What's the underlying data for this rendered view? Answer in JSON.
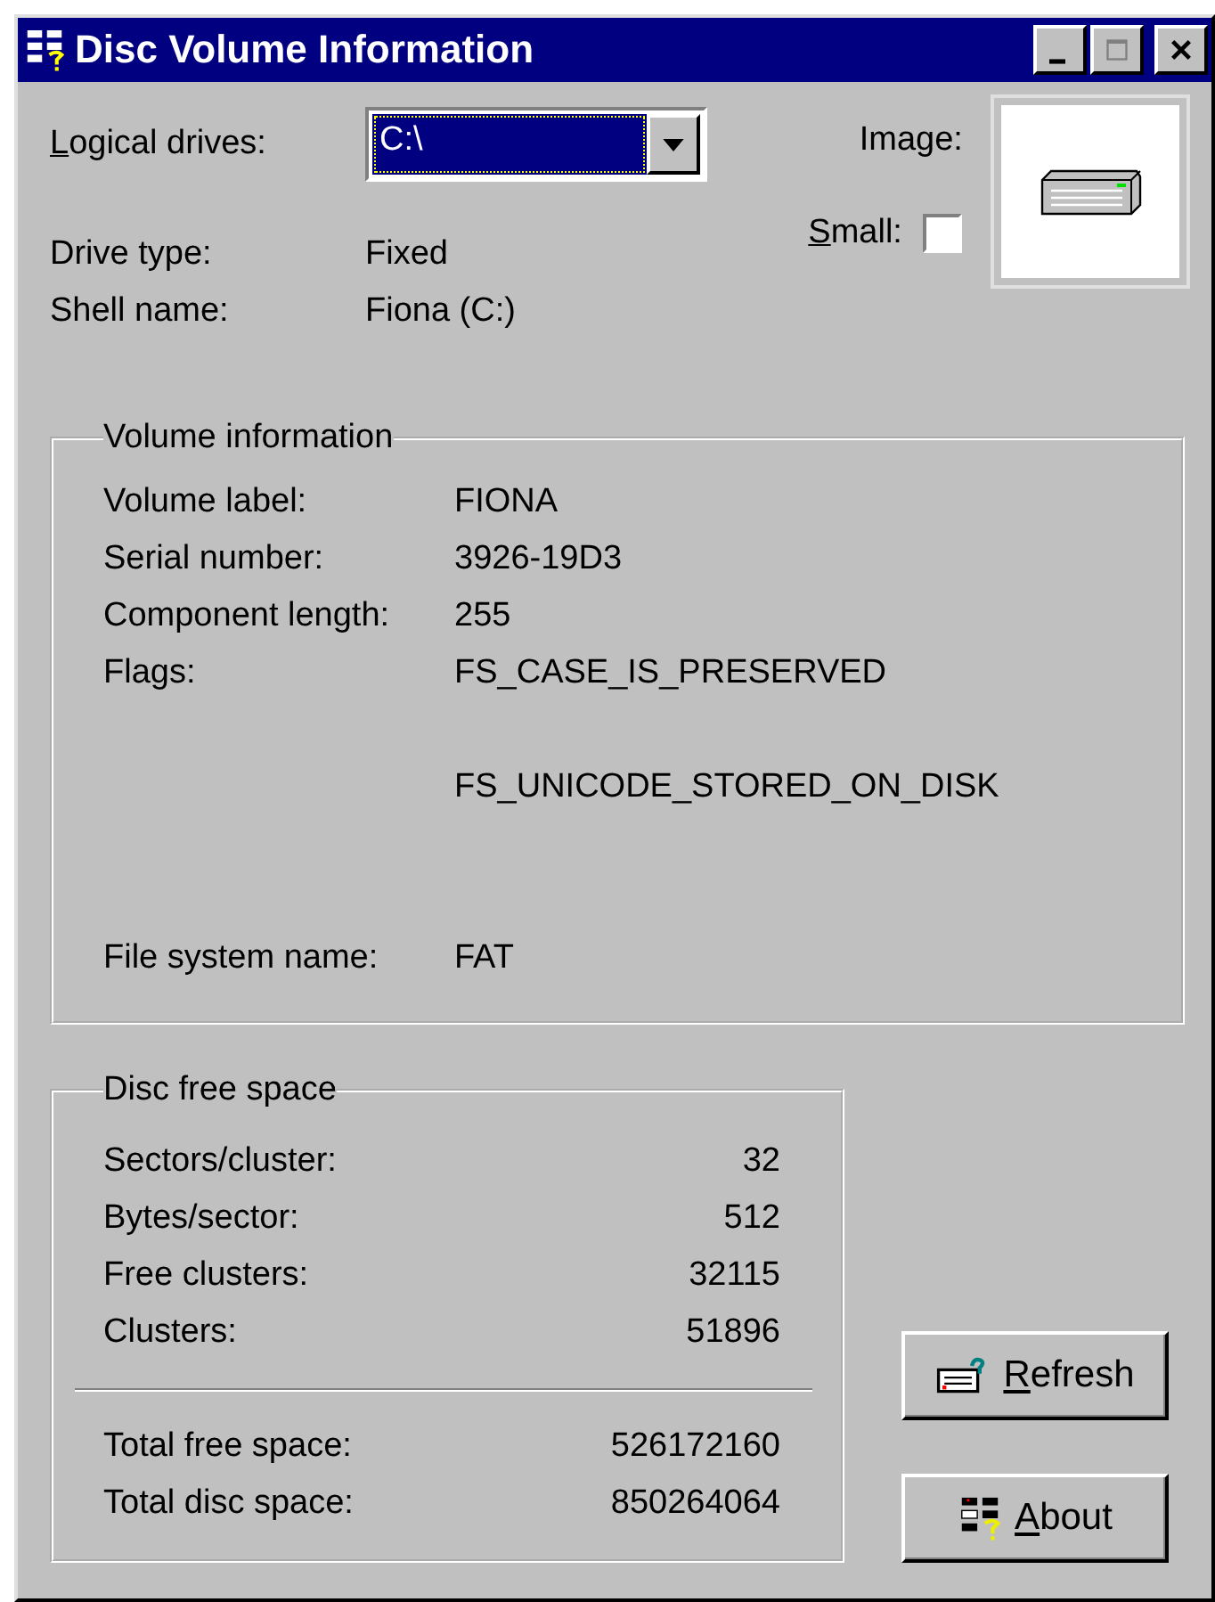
{
  "window": {
    "title": "Disc Volume Information"
  },
  "drive": {
    "label": "Logical drives:",
    "value": "C:\\",
    "image_label": "Image:",
    "small_label": "Small:",
    "small_checked": false
  },
  "drive_info": [
    {
      "label": "Drive type:",
      "value": "Fixed"
    },
    {
      "label": "Shell name:",
      "value": "Fiona (C:)"
    }
  ],
  "volume_information": {
    "title": "Volume information",
    "rows": [
      {
        "label": "Volume label:",
        "values": [
          "FIONA"
        ]
      },
      {
        "label": "Serial number:",
        "values": [
          "3926-19D3"
        ]
      },
      {
        "label": "Component length:",
        "values": [
          "255"
        ]
      },
      {
        "label": "Flags:",
        "values": [
          "FS_CASE_IS_PRESERVED",
          "FS_UNICODE_STORED_ON_DISK"
        ]
      },
      {
        "label": "File system name:",
        "values": [
          "FAT"
        ]
      }
    ]
  },
  "disc_free_space": {
    "title": "Disc free space",
    "rows": [
      {
        "label": "Sectors/cluster:",
        "value": "32"
      },
      {
        "label": "Bytes/sector:",
        "value": "512"
      },
      {
        "label": "Free clusters:",
        "value": "32115"
      },
      {
        "label": "Clusters:",
        "value": "51896"
      }
    ],
    "totals": [
      {
        "label": "Total free space:",
        "value": "526172160"
      },
      {
        "label": "Total disc space:",
        "value": "850264064"
      }
    ]
  },
  "buttons": [
    {
      "kind": "refresh",
      "label": "Refresh"
    },
    {
      "kind": "about",
      "label": "About"
    }
  ]
}
